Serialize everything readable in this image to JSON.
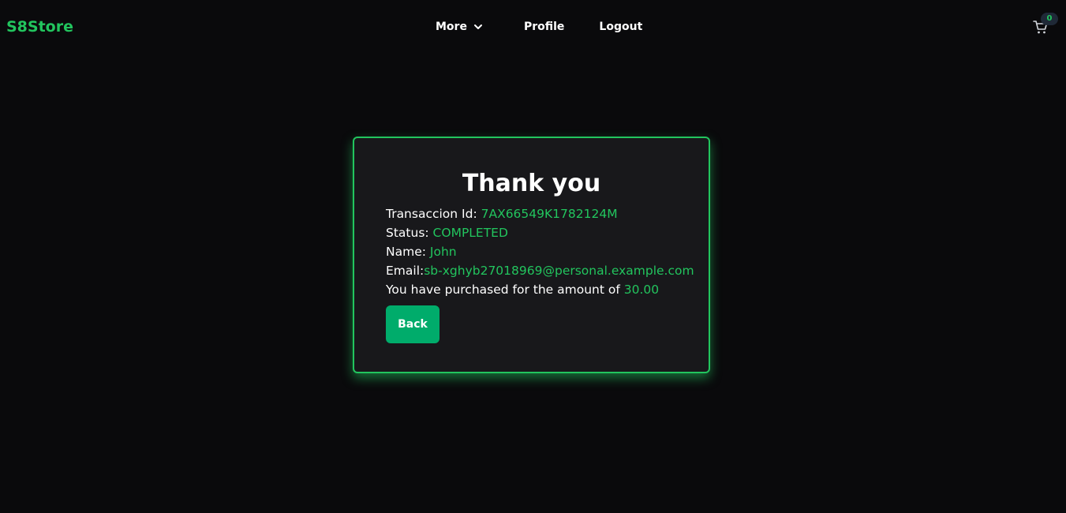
{
  "navbar": {
    "brand": "S8Store",
    "links": {
      "more": "More",
      "profile": "Profile",
      "logout": "Logout"
    },
    "cart_count": "0",
    "icons": {
      "more": "chevron-down-icon",
      "cart": "cart-icon"
    }
  },
  "receipt": {
    "title": "Thank you",
    "transaction_label": "Transaccion Id: ",
    "transaction_id": "7AX66549K1782124M",
    "status_label": "Status: ",
    "status_value": "COMPLETED",
    "name_label": "Name: ",
    "name_value": "John",
    "email_label": "Email:",
    "email_value": "sb-xghyb27018969@personal.example.com",
    "amount_label": "You have purchased for the amount of ",
    "amount_value": "30.00",
    "back_label": "Back"
  },
  "colors": {
    "accent": "#22c55e",
    "button": "#00ac6b",
    "background": "#0a0a0c",
    "card": "#18181b"
  }
}
